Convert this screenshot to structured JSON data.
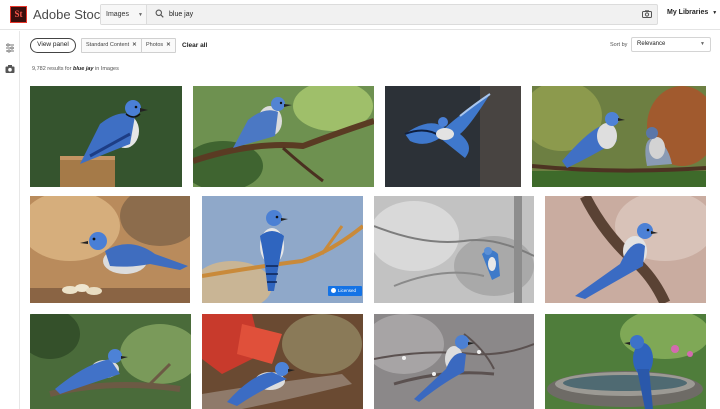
{
  "header": {
    "logo_text": "St",
    "app_name": "Adobe Stock",
    "asset_type": "Images",
    "search_query": "blue jay",
    "libraries_label": "My Libraries"
  },
  "filters": {
    "view_panel_label": "View panel",
    "chips": [
      "Standard Content",
      "Photos"
    ],
    "clear_all_label": "Clear all",
    "sort_label": "Sort by",
    "sort_value": "Relevance"
  },
  "results": {
    "count": "9,782",
    "prefix": "results for",
    "query": "blue jay",
    "suffix": "in Images"
  },
  "badge": {
    "licensed_label": "Licensed"
  },
  "images": [
    {
      "subject": "blue jay on wooden post",
      "bg": "#3b5f33"
    },
    {
      "subject": "blue jay on branch with leaves",
      "bg": "#4f7a3a"
    },
    {
      "subject": "blue jay in flight",
      "bg": "#2f3438"
    },
    {
      "subject": "two blue jays on branch",
      "bg": "#6b7d43"
    },
    {
      "subject": "blue jay with peanuts",
      "bg": "#b48a5c"
    },
    {
      "subject": "blue jay on orange branch",
      "bg": "#8fa7c8"
    },
    {
      "subject": "blue jay in grey tree",
      "bg": "#bcbcbc"
    },
    {
      "subject": "blue jay on curved branch",
      "bg": "#c7a89b"
    },
    {
      "subject": "blue jay on mossy branch",
      "bg": "#4d6b3a"
    },
    {
      "subject": "blue jay with red leaves",
      "bg": "#5e3b2a"
    },
    {
      "subject": "blue jay on snowy branch",
      "bg": "#8a8687"
    },
    {
      "subject": "blue jay on birdbath",
      "bg": "#4e7b3c"
    }
  ]
}
